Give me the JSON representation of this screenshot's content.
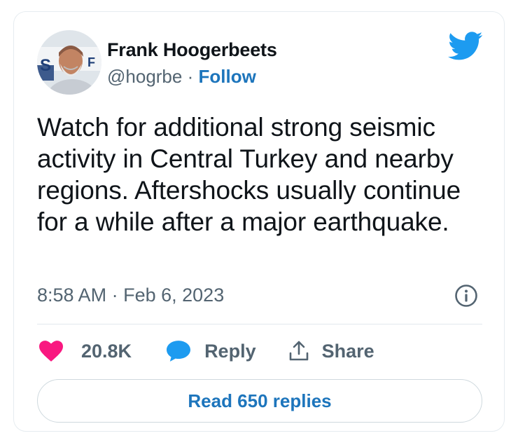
{
  "author": {
    "name": "Frank Hoogerbeets",
    "handle": "@hogrbe",
    "separator": "·",
    "follow_label": "Follow"
  },
  "tweet": {
    "text": "Watch for additional strong seismic activity in Central Turkey and nearby regions. Aftershocks usually continue for a while after a major earthquake.",
    "time": "8:58 AM",
    "date_separator": "·",
    "date": "Feb 6, 2023"
  },
  "actions": {
    "likes_count": "20.8K",
    "reply_label": "Reply",
    "share_label": "Share"
  },
  "read_replies_label": "Read 650 replies",
  "icons": {
    "brand": "twitter-bird-icon",
    "info": "info-icon",
    "like": "heart-icon",
    "reply": "speech-bubble-icon",
    "share": "share-arrow-icon"
  },
  "colors": {
    "brand_blue": "#1d9bf0",
    "link_blue": "#1d75bc",
    "heart": "#f91880",
    "text_primary": "#0f1419",
    "text_secondary": "#536471"
  }
}
